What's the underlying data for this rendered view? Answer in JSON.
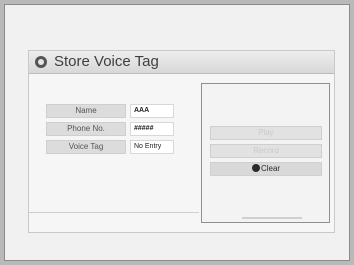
{
  "window": {
    "title": "Store Voice Tag"
  },
  "fields": [
    {
      "label": "Name",
      "value": "AAA"
    },
    {
      "label": "Phone No.",
      "value": "#####"
    },
    {
      "label": "Voice Tag",
      "value": "No Entry"
    }
  ],
  "actions": {
    "play_label": "Play",
    "record_label": "Record",
    "clear_label": "Clear"
  },
  "icons": {
    "title_bullet": "radio-bullet-icon",
    "selection_cursor": "selection-dot-icon"
  }
}
